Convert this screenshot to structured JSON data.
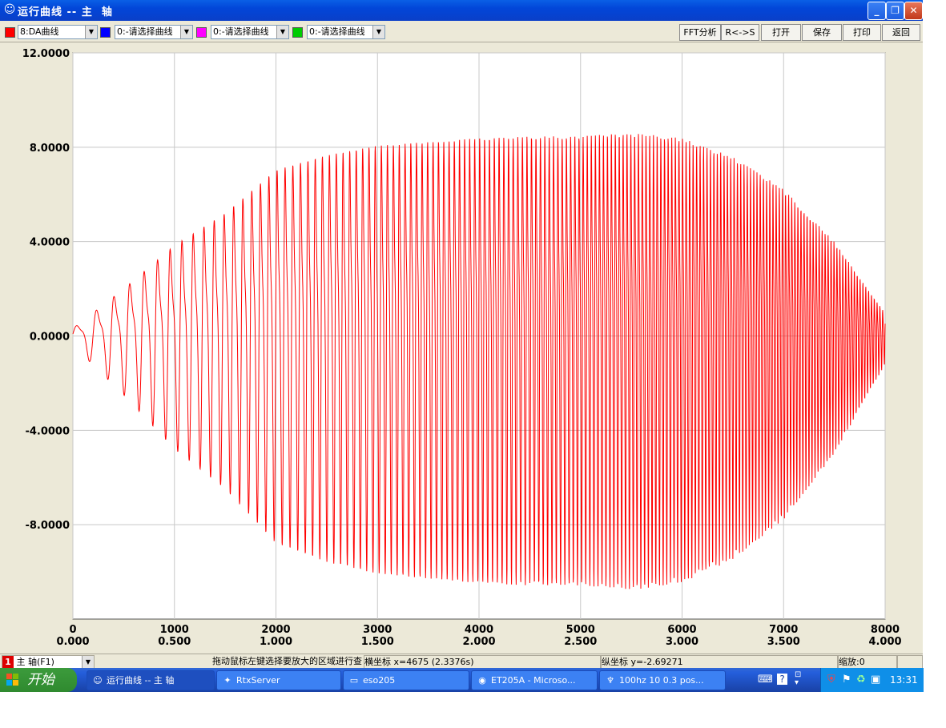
{
  "window": {
    "title": "运行曲线 -- 主  轴",
    "minimize_icon": "minimize-icon",
    "restore_icon": "restore-icon",
    "close_icon": "close-icon"
  },
  "toolbar": {
    "channels": [
      {
        "color": "#ff0000",
        "value": "8:DA曲线"
      },
      {
        "color": "#0000ff",
        "value": "0:-请选择曲线"
      },
      {
        "color": "#ff00ff",
        "value": "0:-请选择曲线"
      },
      {
        "color": "#00cc00",
        "value": "0:-请选择曲线"
      }
    ],
    "buttons": {
      "fft": "FFT分析",
      "rs": "R<->S",
      "open": "打开",
      "save": "保存",
      "print": "打印",
      "back": "返回"
    }
  },
  "chart_data": {
    "type": "line",
    "y_ticks": [
      "12.0000",
      "8.0000",
      "4.0000",
      "0.0000",
      "-4.0000",
      "-8.0000"
    ],
    "ylim": [
      -12,
      12
    ],
    "x_ticks_samples": [
      "0",
      "1000",
      "2000",
      "3000",
      "4000",
      "5000",
      "6000",
      "7000",
      "8000"
    ],
    "x_ticks_seconds": [
      "0.000",
      "0.500",
      "1.000",
      "1.500",
      "2.000",
      "2.500",
      "3.000",
      "3.500",
      "4.000"
    ],
    "xlim": [
      0,
      8000
    ],
    "series": [
      {
        "color": "#ff0000",
        "description": "chirp-like oscillation, amplitude grows to about 10 near x=5000-6000 then decays",
        "envelope_x": [
          0,
          500,
          1000,
          1500,
          2000,
          2500,
          3000,
          3500,
          4000,
          4500,
          5000,
          5500,
          6000,
          6500,
          7000,
          7500,
          8000
        ],
        "envelope_y": [
          0.4,
          2.5,
          4.8,
          6.5,
          8.8,
          9.6,
          10.1,
          10.3,
          10.5,
          10.6,
          10.6,
          10.8,
          10.5,
          9.5,
          7.8,
          5.0,
          1.2
        ]
      }
    ],
    "grid": true
  },
  "status": {
    "axis_selector_index": "1",
    "axis_selector_value": "主  轴(F1)",
    "hint": "拖动鼠标左键选择要放大的区域进行查",
    "x_coord": "横坐标 x=4675 (2.3376s)",
    "y_coord": "纵坐标 y=-2.69271",
    "zoom": "缩放:0"
  },
  "taskbar": {
    "start_label": "开始",
    "tasks": [
      {
        "icon": "app-curve-icon",
        "label": "运行曲线 -- 主  轴",
        "active": true
      },
      {
        "icon": "rtx-icon",
        "label": "RtxServer",
        "active": false
      },
      {
        "icon": "folder-icon",
        "label": "eso205",
        "active": false
      },
      {
        "icon": "browser-icon",
        "label": "ET205A - Microso...",
        "active": false
      },
      {
        "icon": "tool-icon",
        "label": "100hz 10 0.3 pos...",
        "active": false
      }
    ],
    "clock": "13:31"
  }
}
